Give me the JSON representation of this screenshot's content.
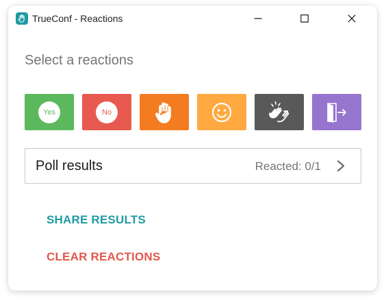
{
  "window": {
    "title": "TrueConf - Reactions",
    "app_icon": "hand-icon",
    "controls": {
      "minimize_icon": "minimize-icon",
      "maximize_icon": "maximize-icon",
      "close_icon": "close-icon"
    }
  },
  "heading": "Select a reactions",
  "reactions": [
    {
      "id": "yes",
      "label": "Yes",
      "icon": "yes-badge-icon",
      "color": "#5cb85c"
    },
    {
      "id": "no",
      "label": "No",
      "icon": "no-badge-icon",
      "color": "#e85a4f"
    },
    {
      "id": "raise-hand",
      "icon": "raised-hand-icon",
      "color": "#f47c20"
    },
    {
      "id": "smile",
      "icon": "smiley-face-icon",
      "color": "#ffa940"
    },
    {
      "id": "applause",
      "icon": "clapping-hands-icon",
      "color": "#595959"
    },
    {
      "id": "leave",
      "icon": "exit-door-icon",
      "color": "#9575cd"
    }
  ],
  "poll": {
    "title": "Poll results",
    "reacted": "Reacted: 0/1",
    "icon": "chevron-right-icon"
  },
  "actions": {
    "share": "SHARE RESULTS",
    "clear": "CLEAR REACTIONS"
  },
  "colors": {
    "brand": "#1f9aa3",
    "share": "#1f9aa3",
    "clear": "#e2574c",
    "heading": "#757575",
    "border": "#c9c9c9"
  }
}
